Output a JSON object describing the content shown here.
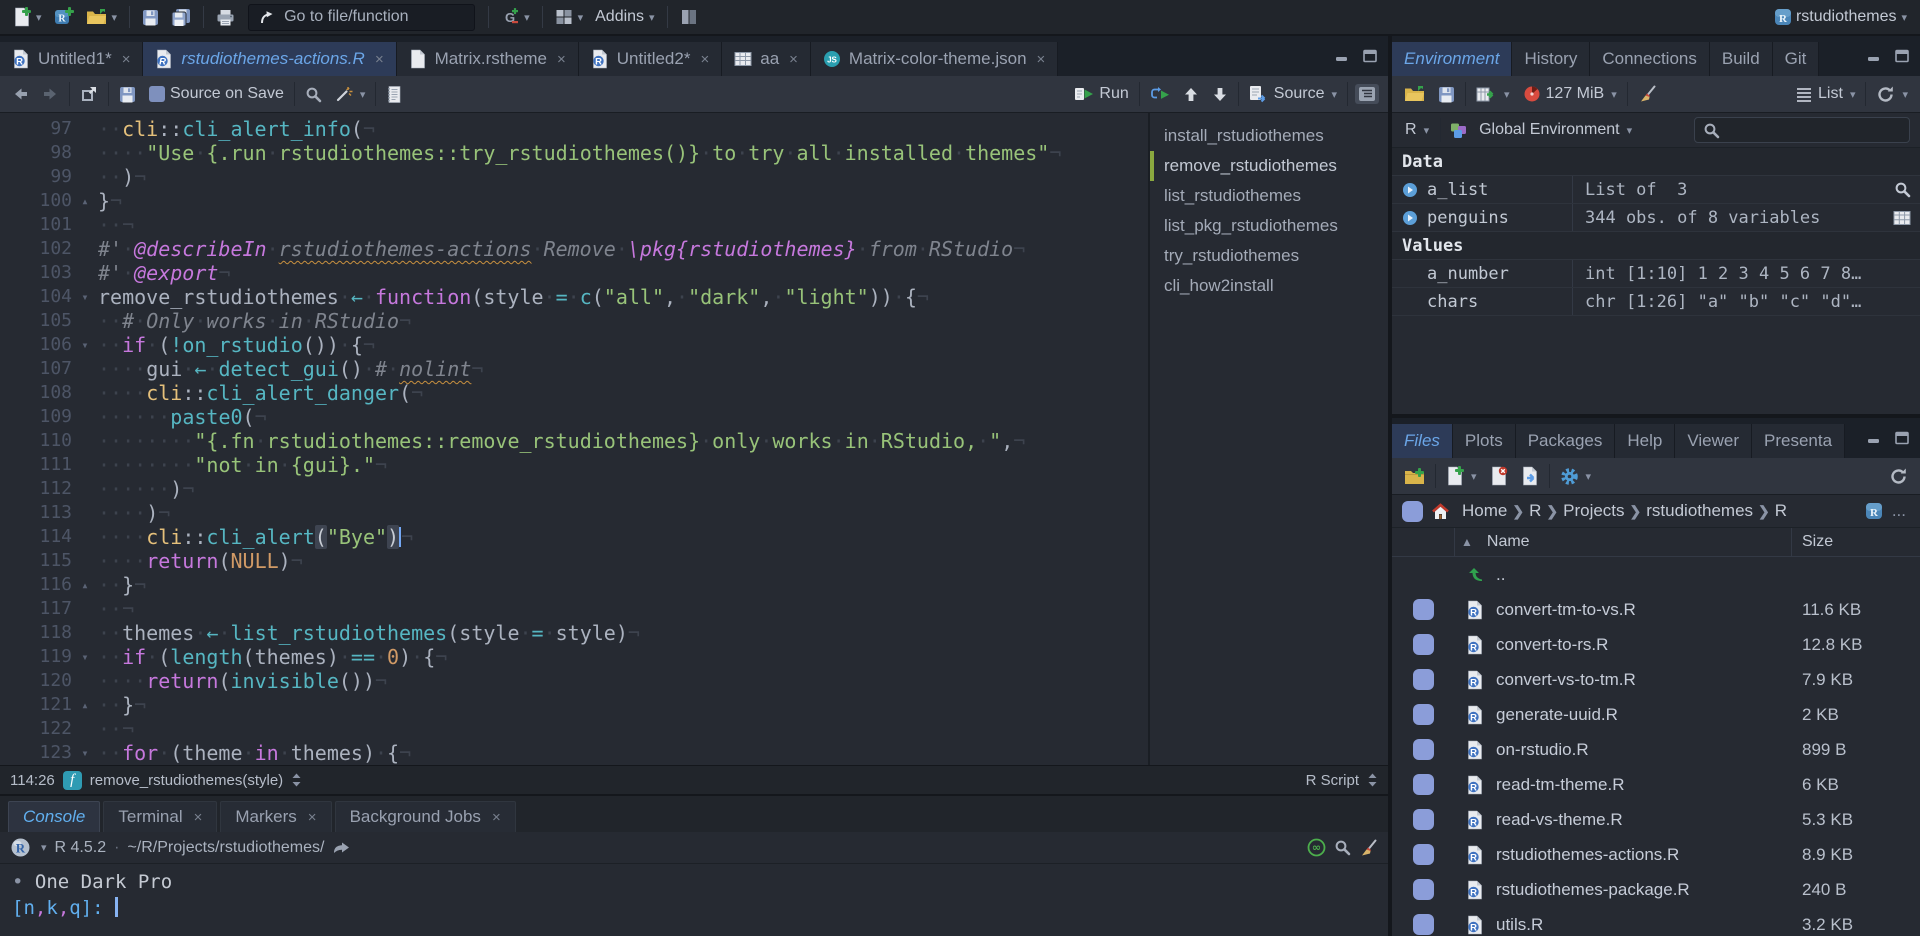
{
  "topbar": {
    "goto_placeholder": "Go to file/function",
    "addins_label": "Addins",
    "project": "rstudiothemes"
  },
  "editor_tabs": [
    {
      "label": "Untitled1*",
      "icon": "r-doc",
      "active": false
    },
    {
      "label": "rstudiothemes-actions.R",
      "icon": "r-doc",
      "active": true
    },
    {
      "label": "Matrix.rstheme",
      "icon": "file",
      "active": false
    },
    {
      "label": "Untitled2*",
      "icon": "r-doc",
      "active": false
    },
    {
      "label": "aa",
      "icon": "table",
      "active": false
    },
    {
      "label": "Matrix-color-theme.json",
      "icon": "js",
      "active": false
    }
  ],
  "editor_toolbar": {
    "source_on_save": "Source on Save",
    "run_label": "Run",
    "source_label": "Source"
  },
  "code": {
    "lines": [
      {
        "n": 97,
        "fold": "",
        "seg": [
          [
            "d",
            "  "
          ],
          [
            "p",
            "cli"
          ],
          [
            "d",
            "::"
          ],
          [
            "f",
            "cli_alert_info"
          ],
          [
            "d",
            "("
          ]
        ]
      },
      {
        "n": 98,
        "fold": "",
        "seg": [
          [
            "d",
            "    "
          ],
          [
            "s",
            "\"Use {.run rstudiothemes::try_rstudiothemes()} to try all installed themes\""
          ]
        ]
      },
      {
        "n": 99,
        "fold": "",
        "seg": [
          [
            "d",
            "  )"
          ]
        ]
      },
      {
        "n": 100,
        "fold": "end",
        "seg": [
          [
            "d",
            "}"
          ]
        ]
      },
      {
        "n": 101,
        "fold": "",
        "seg": [
          [
            "d",
            "  "
          ]
        ]
      },
      {
        "n": 102,
        "fold": "",
        "seg": [
          [
            "c",
            "#' "
          ],
          [
            "r",
            "@describeIn"
          ],
          [
            "c",
            " "
          ],
          [
            "cu",
            "rstudiothemes-actions"
          ],
          [
            "c",
            " Remove "
          ],
          [
            "ri",
            "\\pkg"
          ],
          [
            "ri",
            "{rstudiothemes}"
          ],
          [
            "c",
            " from RStudio"
          ]
        ]
      },
      {
        "n": 103,
        "fold": "",
        "seg": [
          [
            "c",
            "#' "
          ],
          [
            "r",
            "@export"
          ]
        ]
      },
      {
        "n": 104,
        "fold": "start",
        "seg": [
          [
            "d",
            "remove_rstudiothemes "
          ],
          [
            "o",
            "←"
          ],
          [
            "d",
            " "
          ],
          [
            "k",
            "function"
          ],
          [
            "d",
            "(style "
          ],
          [
            "o",
            "="
          ],
          [
            "d",
            " "
          ],
          [
            "f",
            "c"
          ],
          [
            "d",
            "("
          ],
          [
            "s",
            "\"all\""
          ],
          [
            "d",
            ", "
          ],
          [
            "s",
            "\"dark\""
          ],
          [
            "d",
            ", "
          ],
          [
            "s",
            "\"light\""
          ],
          [
            "d",
            ")) {"
          ]
        ]
      },
      {
        "n": 105,
        "fold": "",
        "seg": [
          [
            "d",
            "  "
          ],
          [
            "c",
            "# Only works in RStudio"
          ]
        ]
      },
      {
        "n": 106,
        "fold": "start",
        "seg": [
          [
            "d",
            "  "
          ],
          [
            "k",
            "if"
          ],
          [
            "d",
            " ("
          ],
          [
            "o",
            "!"
          ],
          [
            "f",
            "on_rstudio"
          ],
          [
            "d",
            "()) {"
          ]
        ]
      },
      {
        "n": 107,
        "fold": "",
        "seg": [
          [
            "d",
            "    gui "
          ],
          [
            "o",
            "←"
          ],
          [
            "d",
            " "
          ],
          [
            "f",
            "detect_gui"
          ],
          [
            "d",
            "() "
          ],
          [
            "c",
            "# "
          ],
          [
            "cu",
            "nolint"
          ]
        ]
      },
      {
        "n": 108,
        "fold": "",
        "seg": [
          [
            "d",
            "    "
          ],
          [
            "p",
            "cli"
          ],
          [
            "d",
            "::"
          ],
          [
            "f",
            "cli_alert_danger"
          ],
          [
            "d",
            "("
          ]
        ]
      },
      {
        "n": 109,
        "fold": "",
        "seg": [
          [
            "d",
            "      "
          ],
          [
            "f",
            "paste0"
          ],
          [
            "d",
            "("
          ]
        ]
      },
      {
        "n": 110,
        "fold": "",
        "seg": [
          [
            "d",
            "        "
          ],
          [
            "s",
            "\"{.fn rstudiothemes::remove_rstudiothemes} only works in RStudio, \""
          ],
          [
            "d",
            ","
          ]
        ]
      },
      {
        "n": 111,
        "fold": "",
        "seg": [
          [
            "d",
            "        "
          ],
          [
            "s",
            "\"not in {gui}.\""
          ]
        ]
      },
      {
        "n": 112,
        "fold": "",
        "seg": [
          [
            "d",
            "      )"
          ]
        ]
      },
      {
        "n": 113,
        "fold": "",
        "seg": [
          [
            "d",
            "    )"
          ]
        ]
      },
      {
        "n": 114,
        "fold": "",
        "seg": [
          [
            "d",
            "    "
          ],
          [
            "p",
            "cli"
          ],
          [
            "d",
            "::"
          ],
          [
            "f",
            "cli_alert"
          ],
          [
            "hl",
            "("
          ],
          [
            "s",
            "\"Bye\""
          ],
          [
            "hl",
            ")"
          ],
          [
            "cur",
            ""
          ]
        ]
      },
      {
        "n": 115,
        "fold": "",
        "seg": [
          [
            "d",
            "    "
          ],
          [
            "k",
            "return"
          ],
          [
            "d",
            "("
          ],
          [
            "n",
            "NULL"
          ],
          [
            "d",
            ")"
          ]
        ]
      },
      {
        "n": 116,
        "fold": "end",
        "seg": [
          [
            "d",
            "  }"
          ]
        ]
      },
      {
        "n": 117,
        "fold": "",
        "seg": [
          [
            "d",
            "  "
          ]
        ]
      },
      {
        "n": 118,
        "fold": "",
        "seg": [
          [
            "d",
            "  themes "
          ],
          [
            "o",
            "←"
          ],
          [
            "d",
            " "
          ],
          [
            "f",
            "list_rstudiothemes"
          ],
          [
            "d",
            "(style "
          ],
          [
            "o",
            "="
          ],
          [
            "d",
            " style)"
          ]
        ]
      },
      {
        "n": 119,
        "fold": "start",
        "seg": [
          [
            "d",
            "  "
          ],
          [
            "k",
            "if"
          ],
          [
            "d",
            " ("
          ],
          [
            "f",
            "length"
          ],
          [
            "d",
            "(themes) "
          ],
          [
            "o",
            "=="
          ],
          [
            "d",
            " "
          ],
          [
            "n",
            "0"
          ],
          [
            "d",
            ") {"
          ]
        ]
      },
      {
        "n": 120,
        "fold": "",
        "seg": [
          [
            "d",
            "    "
          ],
          [
            "k",
            "return"
          ],
          [
            "d",
            "("
          ],
          [
            "f",
            "invisible"
          ],
          [
            "d",
            "())"
          ]
        ]
      },
      {
        "n": 121,
        "fold": "end",
        "seg": [
          [
            "d",
            "  }"
          ]
        ]
      },
      {
        "n": 122,
        "fold": "",
        "seg": [
          [
            "d",
            "  "
          ]
        ]
      },
      {
        "n": 123,
        "fold": "start",
        "seg": [
          [
            "d",
            "  "
          ],
          [
            "k",
            "for"
          ],
          [
            "d",
            " (theme "
          ],
          [
            "k",
            "in"
          ],
          [
            "d",
            " themes) {"
          ]
        ]
      }
    ]
  },
  "outline": {
    "items": [
      "install_rstudiothemes",
      "remove_rstudiothemes",
      "list_rstudiothemes",
      "list_pkg_rstudiothemes",
      "try_rstudiothemes",
      "cli_how2install"
    ],
    "active": "remove_rstudiothemes"
  },
  "status": {
    "position": "114:26",
    "scope": "remove_rstudiothemes(style)",
    "file_type": "R Script"
  },
  "console": {
    "tabs": [
      {
        "label": "Console",
        "active": true,
        "closable": false
      },
      {
        "label": "Terminal",
        "active": false,
        "closable": true
      },
      {
        "label": "Markers",
        "active": false,
        "closable": true
      },
      {
        "label": "Background Jobs",
        "active": false,
        "closable": true
      }
    ],
    "r_version": "R 4.5.2",
    "dot": "·",
    "cwd": "~/R/Projects/rstudiothemes/",
    "output_bullet": "•",
    "output_text": "One Dark Pro",
    "prompt_segs": [
      [
        "pb",
        "["
      ],
      [
        "pb",
        "n"
      ],
      [
        "pc",
        ","
      ],
      [
        "pb",
        "k"
      ],
      [
        "pc",
        ","
      ],
      [
        "pb",
        "q"
      ],
      [
        "pb",
        "]"
      ],
      [
        "pb",
        ":"
      ]
    ]
  },
  "environment": {
    "tabs": [
      "Environment",
      "History",
      "Connections",
      "Build",
      "Git"
    ],
    "active_tab": "Environment",
    "memory": "127 MiB",
    "language": "R",
    "scope": "Global Environment",
    "view_label": "List",
    "sections": [
      {
        "title": "Data",
        "rows": [
          {
            "name": "a_list",
            "value": "List of  3",
            "icon": "expand",
            "action": "magnifier"
          },
          {
            "name": "penguins",
            "value": "344 obs. of 8 variables",
            "icon": "expand",
            "action": "grid"
          }
        ]
      },
      {
        "title": "Values",
        "rows": [
          {
            "name": "a_number",
            "value": "int [1:10] 1 2 3 4 5 6 7 8…",
            "icon": "",
            "action": ""
          },
          {
            "name": "chars",
            "value": "chr [1:26] \"a\" \"b\" \"c\" \"d\"…",
            "icon": "",
            "action": ""
          }
        ]
      }
    ]
  },
  "files": {
    "tabs": [
      "Files",
      "Plots",
      "Packages",
      "Help",
      "Viewer",
      "Presenta"
    ],
    "active_tab": "Files",
    "breadcrumb": [
      "Home",
      "R",
      "Projects",
      "rstudiothemes",
      "R"
    ],
    "more_label": "...",
    "columns": {
      "name": "Name",
      "size": "Size"
    },
    "up_label": "..",
    "rows": [
      {
        "name": "convert-tm-to-vs.R",
        "size": "11.6 KB"
      },
      {
        "name": "convert-to-rs.R",
        "size": "12.8 KB"
      },
      {
        "name": "convert-vs-to-tm.R",
        "size": "7.9 KB"
      },
      {
        "name": "generate-uuid.R",
        "size": "2 KB"
      },
      {
        "name": "on-rstudio.R",
        "size": "899 B"
      },
      {
        "name": "read-tm-theme.R",
        "size": "6 KB"
      },
      {
        "name": "read-vs-theme.R",
        "size": "5.3 KB"
      },
      {
        "name": "rstudiothemes-actions.R",
        "size": "8.9 KB"
      },
      {
        "name": "rstudiothemes-package.R",
        "size": "240 B"
      },
      {
        "name": "utils.R",
        "size": "3.2 KB"
      }
    ]
  },
  "colors": {
    "accent": "#61afef",
    "string": "#98c379",
    "keyword": "#c678dd",
    "function": "#56b6c2",
    "constant": "#d19a66",
    "package": "#e5c07b",
    "comment": "#7f848e",
    "editor_bg": "#262a32"
  }
}
